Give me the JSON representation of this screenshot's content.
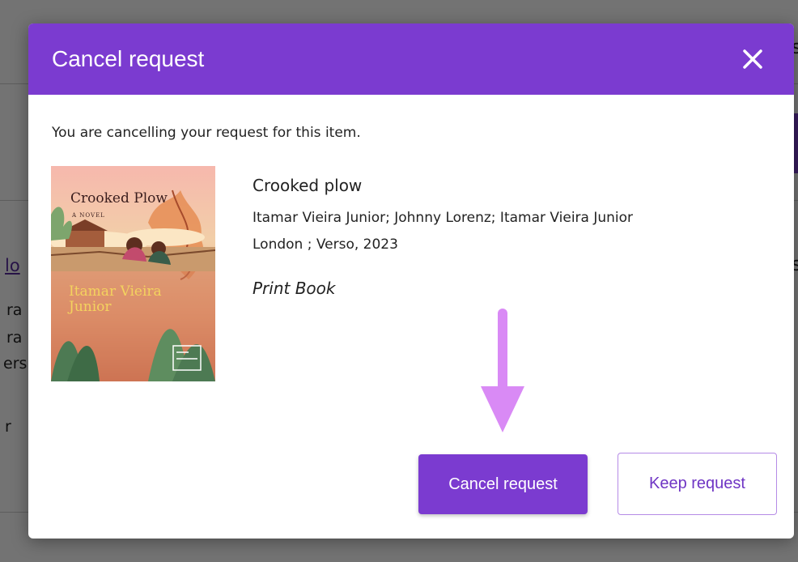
{
  "background": {
    "fragments": [
      "s",
      "lo",
      "ra",
      "ra",
      "ers",
      "r",
      "s"
    ]
  },
  "modal": {
    "title": "Cancel request",
    "close_icon": "close-icon",
    "intro": "You are cancelling your request for this item.",
    "cover": {
      "title": "Crooked Plow",
      "subtitle": "A NOVEL",
      "author": "Itamar Vieira Junior"
    },
    "item": {
      "title": "Crooked plow",
      "authors": "Itamar Vieira Junior; Johnny Lorenz; Itamar Vieira Junior",
      "publication": "London ; Verso, 2023",
      "format": "Print Book"
    },
    "buttons": {
      "cancel_label": "Cancel request",
      "keep_label": "Keep request"
    }
  },
  "colors": {
    "header": "#7b3bd0",
    "arrow": "#d98af5",
    "keep_text": "#6f35c4"
  }
}
